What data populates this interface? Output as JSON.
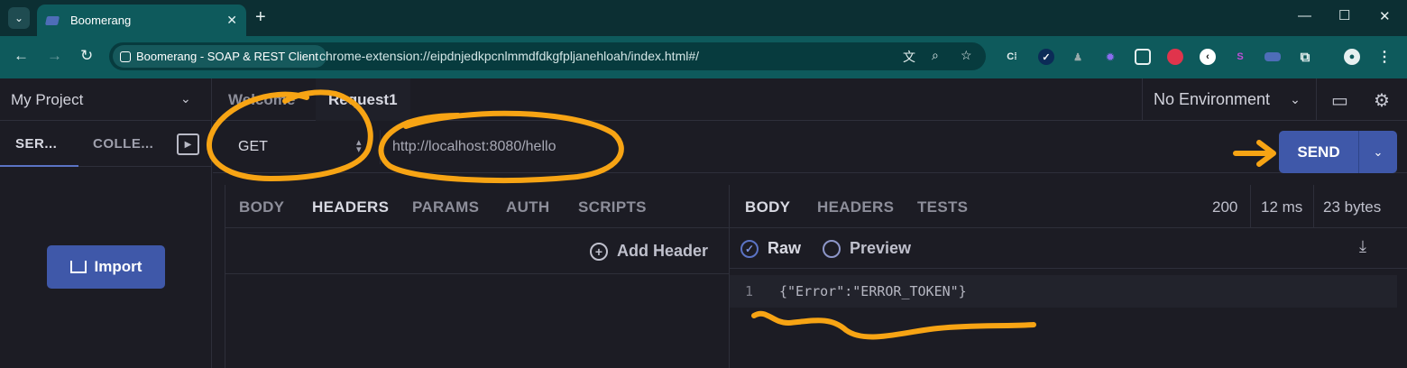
{
  "browser": {
    "tab_title": "Boomerang",
    "site_chip": "Boomerang - SOAP & REST Client",
    "url": "chrome-extension://eipdnjedkpcnlmmdfdkgfpljanehloah/index.html#/"
  },
  "sidebar": {
    "project": "My Project",
    "tabs": [
      "SER...",
      "COLLE..."
    ],
    "import_label": "Import"
  },
  "request_tabs": [
    "Welcome",
    "Request1"
  ],
  "environment": "No Environment",
  "request": {
    "method": "GET",
    "url": "http://localhost:8080/hello",
    "send_label": "SEND"
  },
  "request_panel": {
    "tabs": [
      "BODY",
      "HEADERS",
      "PARAMS",
      "AUTH",
      "SCRIPTS"
    ],
    "active_tab": "HEADERS",
    "add_header": "Add Header"
  },
  "response_panel": {
    "tabs": [
      "BODY",
      "HEADERS",
      "TESTS"
    ],
    "active_tab": "BODY",
    "status": "200",
    "time": "12 ms",
    "size": "23 bytes",
    "raw_label": "Raw",
    "preview_label": "Preview",
    "line_number": "1",
    "body": "{\"Error\":\"ERROR_TOKEN\"}"
  },
  "colors": {
    "accent": "#3f58a9",
    "annotation": "#f7a414",
    "chrome_frame": "#0e5a5c",
    "app_bg": "#1c1c24"
  }
}
